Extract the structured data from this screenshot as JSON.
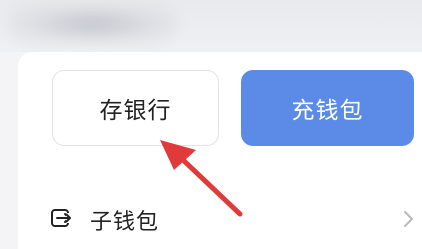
{
  "buttons": {
    "deposit_bank_label": "存银行",
    "charge_wallet_label": "充钱包"
  },
  "list": {
    "sub_wallet_label": "子钱包"
  },
  "icons": {
    "row_icon": "wallet-export-icon",
    "row_chevron": "chevron-right-icon",
    "annotation": "red-arrow-pointer"
  },
  "colors": {
    "primary": "#5b8be6",
    "annotation": "#e03a3a",
    "page_background": "#f4f4f6"
  }
}
